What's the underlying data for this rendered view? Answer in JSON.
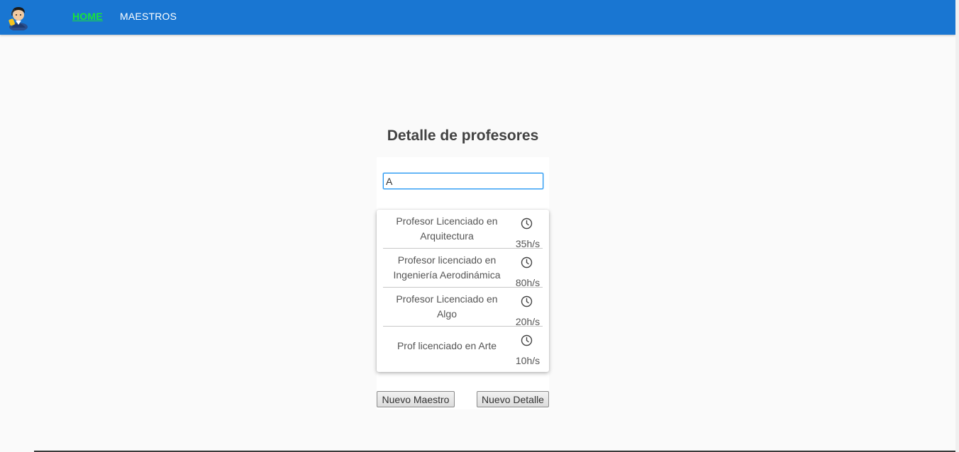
{
  "header": {
    "logo_icon": "user-support-avatar",
    "nav": [
      {
        "label": "HOME",
        "active": true
      },
      {
        "label": "MAESTROS",
        "active": false
      }
    ],
    "active_color": "#18e23a",
    "bar_color": "#1976d2"
  },
  "main": {
    "title": "Detalle de profesores",
    "search": {
      "value": "A",
      "placeholder": ""
    },
    "results": [
      {
        "desc_lines": [
          "Profesor Licenciado en",
          "Arquitectura"
        ],
        "hours": "35h/s",
        "icon": "clock-icon"
      },
      {
        "desc_lines": [
          "Profesor licenciado en",
          "Ingeniería Aerodinámica"
        ],
        "hours": "80h/s",
        "icon": "clock-icon"
      },
      {
        "desc_lines": [
          "Profesor Licenciado en",
          "Algo"
        ],
        "hours": "20h/s",
        "icon": "clock-icon"
      },
      {
        "desc_lines": [
          "Prof licenciado en Arte"
        ],
        "hours": "10h/s",
        "icon": "clock-icon"
      }
    ],
    "buttons": {
      "nuevo_maestro": "Nuevo Maestro",
      "nuevo_detalle": "Nuevo Detalle"
    }
  }
}
